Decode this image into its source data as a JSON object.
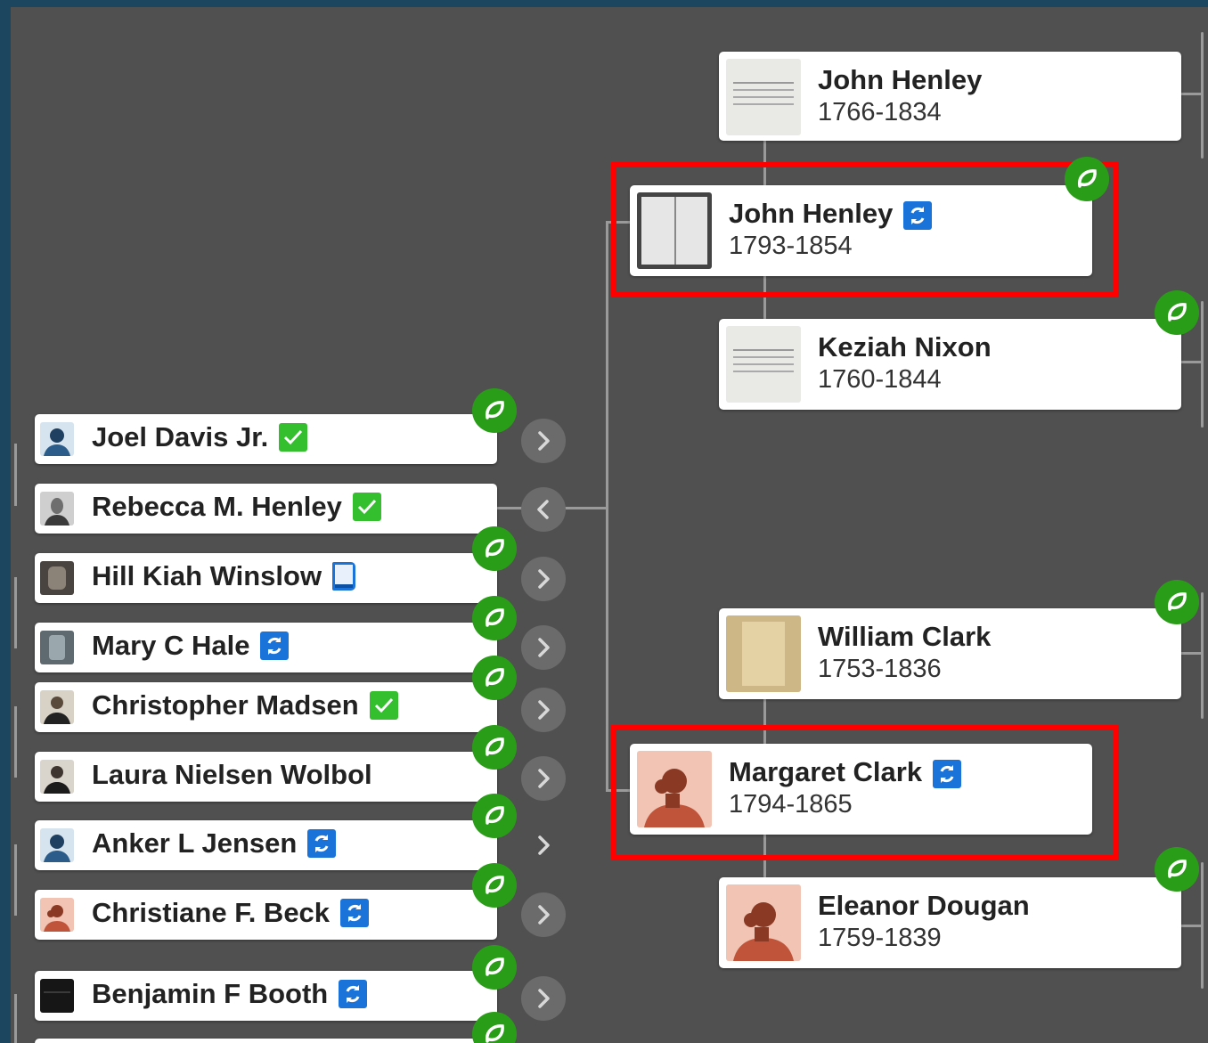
{
  "ancestors": [
    {
      "name": "John Henley",
      "years": "1766-1834",
      "photo": "document"
    },
    {
      "name": "John Henley",
      "years": "1793-1854",
      "photo": "book-scan",
      "badge": "sync-icon",
      "highlighted": true
    },
    {
      "name": "Keziah Nixon",
      "years": "1760-1844",
      "photo": "document"
    },
    {
      "name": "William Clark",
      "years": "1753-1836",
      "photo": "parchment"
    },
    {
      "name": "Margaret Clark",
      "years": "1794-1865",
      "photo": "female-avatar",
      "badge": "sync-icon",
      "highlighted": true
    },
    {
      "name": "Eleanor Dougan",
      "years": "1759-1839",
      "photo": "female-avatar"
    }
  ],
  "descendants": [
    {
      "name": "Joel Davis Jr.",
      "badge": "check-icon",
      "avatar": "male-avatar"
    },
    {
      "name": "Rebecca M. Henley",
      "badge": "check-icon",
      "avatar": "portrait"
    },
    {
      "name": "Hill Kiah Winslow",
      "badge": "book-icon",
      "avatar": "headstone"
    },
    {
      "name": "Mary C Hale",
      "badge": "sync-icon",
      "avatar": "headstone"
    },
    {
      "name": "Christopher Madsen",
      "badge": "check-icon",
      "avatar": "portrait"
    },
    {
      "name": "Laura Nielsen Wolbol",
      "badge": "",
      "avatar": "portrait"
    },
    {
      "name": "Anker L Jensen",
      "badge": "sync-icon",
      "avatar": "male-avatar"
    },
    {
      "name": "Christiane F. Beck",
      "badge": "sync-icon",
      "avatar": "female-avatar"
    },
    {
      "name": "Benjamin F Booth",
      "badge": "sync-icon",
      "avatar": "dark-photo"
    }
  ],
  "colors": {
    "hint_green": "#2a9d18",
    "sync_blue": "#1a73d9",
    "check_green": "#34c02e",
    "highlight": "#ff0000",
    "female_bg": "#f1c4b4",
    "male_bg": "#d6e4ef"
  }
}
